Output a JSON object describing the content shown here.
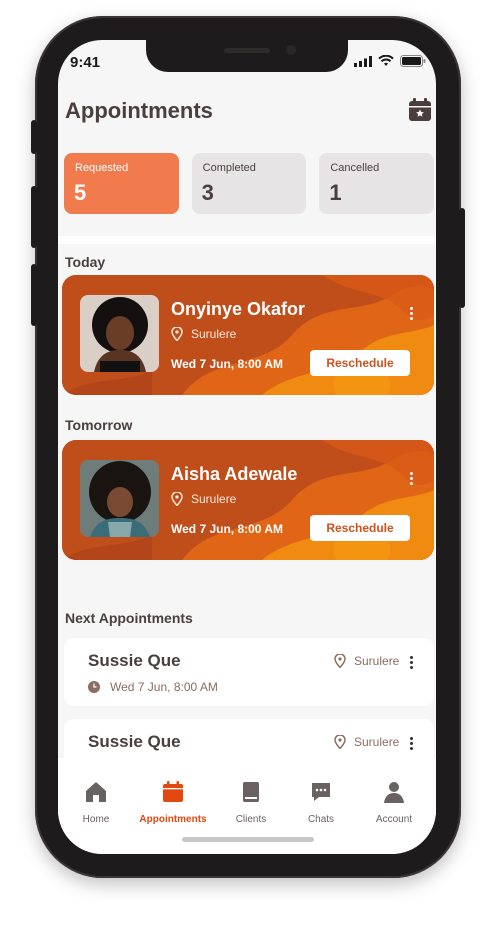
{
  "status": {
    "time": "9:41"
  },
  "header": {
    "title": "Appointments"
  },
  "summary": [
    {
      "label": "Requested",
      "count": "5",
      "active": true
    },
    {
      "label": "Completed",
      "count": "3",
      "active": false
    },
    {
      "label": "Cancelled",
      "count": "1",
      "active": false
    }
  ],
  "sections": {
    "today": "Today",
    "tomorrow": "Tomorrow",
    "next": "Next Appointments"
  },
  "today_card": {
    "name": "Onyinye Okafor",
    "location": "Surulere",
    "when": "Wed 7 Jun, 8:00 AM",
    "action": "Reschedule"
  },
  "tomorrow_card": {
    "name": "Aisha Adewale",
    "location": "Surulere",
    "when": "Wed 7 Jun, 8:00 AM",
    "action": "Reschedule"
  },
  "next_appointments": [
    {
      "name": "Sussie Que",
      "location": "Surulere",
      "when": "Wed 7 Jun, 8:00 AM"
    },
    {
      "name": "Sussie Que",
      "location": "Surulere"
    }
  ],
  "tabs": [
    {
      "label": "Home",
      "icon": "home-icon",
      "active": false
    },
    {
      "label": "Appointments",
      "icon": "calendar-icon",
      "active": true
    },
    {
      "label": "Clients",
      "icon": "book-icon",
      "active": false
    },
    {
      "label": "Chats",
      "icon": "chat-icon",
      "active": false
    },
    {
      "label": "Account",
      "icon": "account-icon",
      "active": false
    }
  ],
  "colors": {
    "accent": "#E2480F",
    "card_orange": "#C04E1B",
    "summary_active": "#F27B4D",
    "text_dark": "#4A3E3E",
    "muted_brown": "#8C6D5F"
  }
}
